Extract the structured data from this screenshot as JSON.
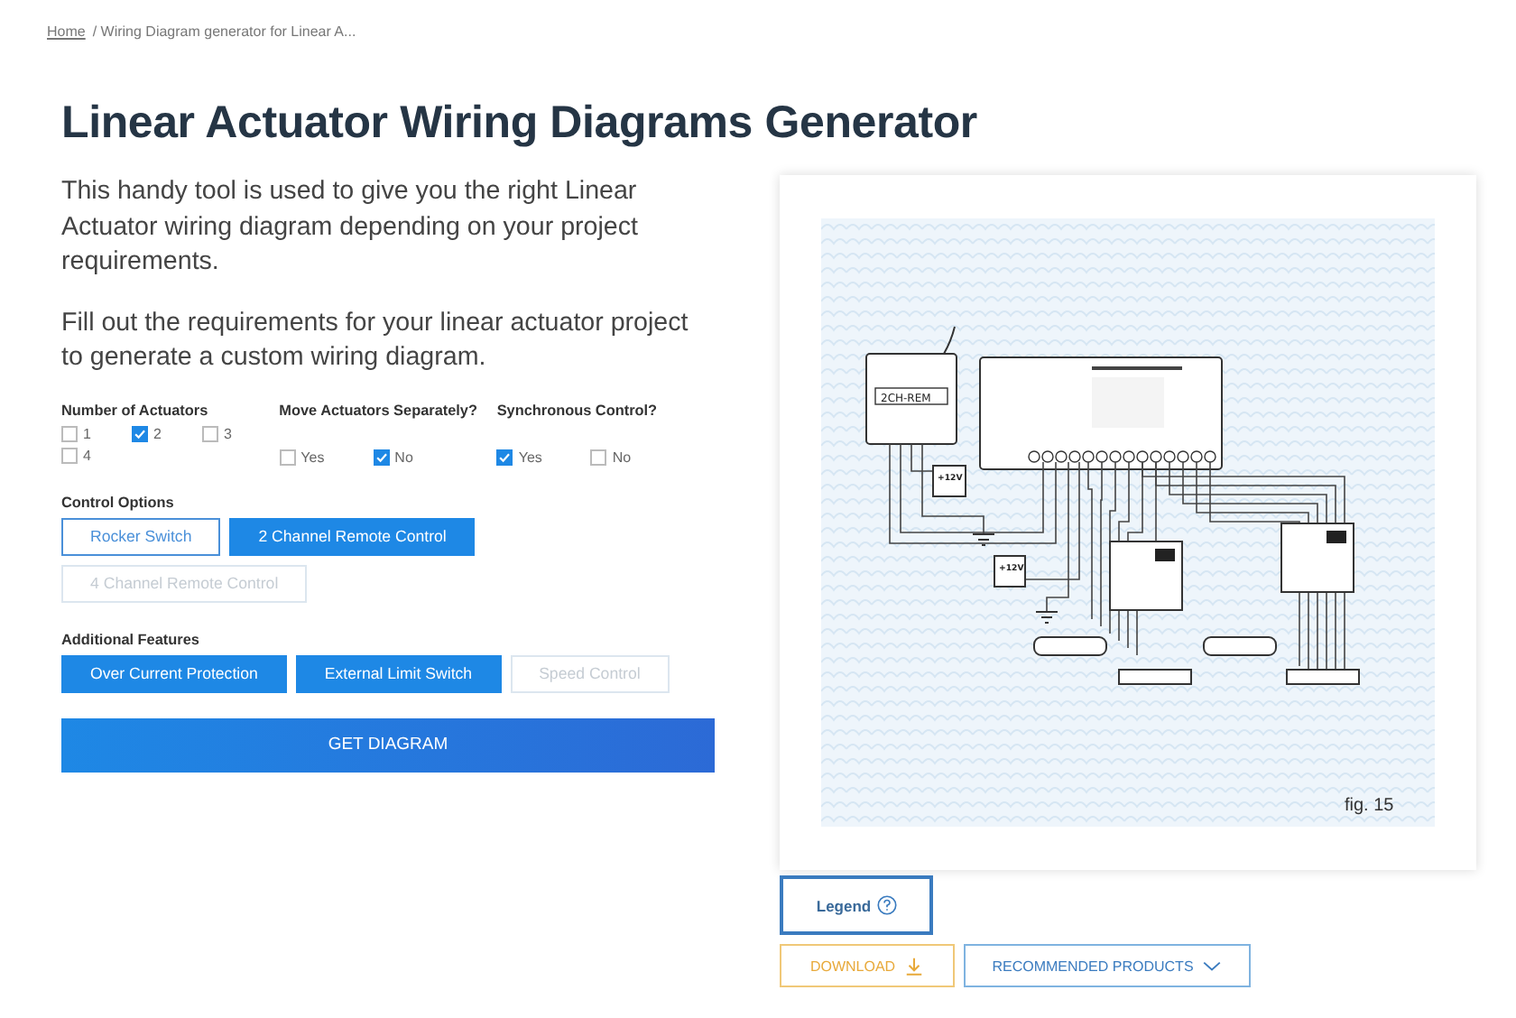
{
  "breadcrumb": {
    "home": "Home",
    "current": "/ Wiring Diagram generator for Linear A..."
  },
  "title": "Linear Actuator Wiring Diagrams Generator",
  "paragraphs": [
    "This handy tool is used to give you the right Linear Actuator wiring diagram depending on your project requirements.",
    "Fill out the requirements for your linear actuator project to generate a custom wiring diagram."
  ],
  "option_groups": [
    {
      "label": "Number of Actuators",
      "options": [
        {
          "label": "1",
          "checked": false
        },
        {
          "label": "2",
          "checked": true
        },
        {
          "label": "3",
          "checked": false
        },
        {
          "label": "4",
          "checked": false
        }
      ]
    },
    {
      "label": "Move Actuators Separately?",
      "options": [
        {
          "label": "Yes",
          "checked": false
        },
        {
          "label": "No",
          "checked": true
        }
      ]
    },
    {
      "label": "Synchronous Control?",
      "options": [
        {
          "label": "Yes",
          "checked": true
        },
        {
          "label": "No",
          "checked": false
        }
      ]
    }
  ],
  "control_options": {
    "label": "Control Options",
    "buttons": [
      {
        "label": "Rocker Switch",
        "selected": false,
        "disabled": false
      },
      {
        "label": "2 Channel Remote Control",
        "selected": true,
        "disabled": false
      },
      {
        "label": "4 Channel Remote Control",
        "selected": false,
        "disabled": true
      }
    ]
  },
  "additional_features": {
    "label": "Additional Features",
    "buttons": [
      {
        "label": "Over Current Protection",
        "selected": true,
        "disabled": false
      },
      {
        "label": "External Limit Switch",
        "selected": true,
        "disabled": false
      },
      {
        "label": "Speed Control",
        "selected": false,
        "disabled": true
      }
    ]
  },
  "get_diagram": "GET DIAGRAM",
  "diagram": {
    "remote_label": "2CH-REM",
    "supply_labels": [
      "+12V",
      "+12V"
    ],
    "caption": "fig. 15"
  },
  "legend": "Legend",
  "actions": [
    {
      "label": "DOWNLOAD",
      "kind": "download"
    },
    {
      "label": "RECOMMENDED PRODUCTS",
      "kind": "dropdown"
    }
  ]
}
